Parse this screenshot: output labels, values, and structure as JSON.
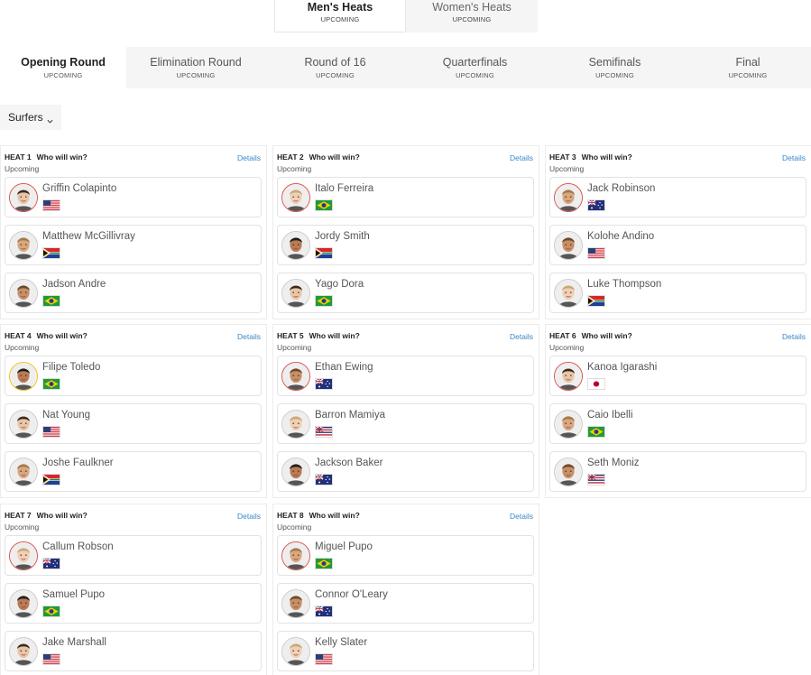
{
  "gender_tabs": [
    {
      "label": "Men's Heats",
      "status": "UPCOMING",
      "active": true
    },
    {
      "label": "Women's Heats",
      "status": "UPCOMING",
      "active": false
    }
  ],
  "round_tabs": [
    {
      "label": "Opening Round",
      "status": "UPCOMING",
      "active": true
    },
    {
      "label": "Elimination Round",
      "status": "UPCOMING",
      "active": false
    },
    {
      "label": "Round of 16",
      "status": "UPCOMING",
      "active": false
    },
    {
      "label": "Quarterfinals",
      "status": "UPCOMING",
      "active": false
    },
    {
      "label": "Semifinals",
      "status": "UPCOMING",
      "active": false
    },
    {
      "label": "Final",
      "status": "UPCOMING",
      "active": false
    }
  ],
  "filter": {
    "label": "Surfers"
  },
  "heat_question": "Who will win?",
  "heat_status": "Upcoming",
  "details_label": "Details",
  "heats": [
    {
      "label": "HEAT 1",
      "surfers": [
        {
          "name": "Griffin Colapinto",
          "flag": "usa",
          "ring": "red"
        },
        {
          "name": "Matthew McGillivray",
          "flag": "south-africa",
          "ring": "none"
        },
        {
          "name": "Jadson Andre",
          "flag": "brazil",
          "ring": "none"
        }
      ]
    },
    {
      "label": "HEAT 2",
      "surfers": [
        {
          "name": "Italo Ferreira",
          "flag": "brazil",
          "ring": "red"
        },
        {
          "name": "Jordy Smith",
          "flag": "south-africa",
          "ring": "none"
        },
        {
          "name": "Yago Dora",
          "flag": "brazil",
          "ring": "none"
        }
      ]
    },
    {
      "label": "HEAT 3",
      "surfers": [
        {
          "name": "Jack Robinson",
          "flag": "australia",
          "ring": "red"
        },
        {
          "name": "Kolohe Andino",
          "flag": "usa",
          "ring": "none"
        },
        {
          "name": "Luke Thompson",
          "flag": "south-africa",
          "ring": "none"
        }
      ]
    },
    {
      "label": "HEAT 4",
      "surfers": [
        {
          "name": "Filipe Toledo",
          "flag": "brazil",
          "ring": "yellow"
        },
        {
          "name": "Nat Young",
          "flag": "usa",
          "ring": "none"
        },
        {
          "name": "Joshe Faulkner",
          "flag": "south-africa",
          "ring": "none"
        }
      ]
    },
    {
      "label": "HEAT 5",
      "surfers": [
        {
          "name": "Ethan Ewing",
          "flag": "australia",
          "ring": "red"
        },
        {
          "name": "Barron Mamiya",
          "flag": "hawaii",
          "ring": "none"
        },
        {
          "name": "Jackson Baker",
          "flag": "australia",
          "ring": "none"
        }
      ]
    },
    {
      "label": "HEAT 6",
      "surfers": [
        {
          "name": "Kanoa Igarashi",
          "flag": "japan",
          "ring": "red"
        },
        {
          "name": "Caio Ibelli",
          "flag": "brazil",
          "ring": "none"
        },
        {
          "name": "Seth Moniz",
          "flag": "hawaii",
          "ring": "none"
        }
      ]
    },
    {
      "label": "HEAT 7",
      "surfers": [
        {
          "name": "Callum Robson",
          "flag": "australia",
          "ring": "red"
        },
        {
          "name": "Samuel Pupo",
          "flag": "brazil",
          "ring": "none"
        },
        {
          "name": "Jake Marshall",
          "flag": "usa",
          "ring": "none"
        }
      ]
    },
    {
      "label": "HEAT 8",
      "surfers": [
        {
          "name": "Miguel Pupo",
          "flag": "brazil",
          "ring": "red"
        },
        {
          "name": "Connor O'Leary",
          "flag": "australia",
          "ring": "none"
        },
        {
          "name": "Kelly Slater",
          "flag": "usa",
          "ring": "none"
        }
      ]
    }
  ],
  "colors": {
    "link": "#3a87c8",
    "ring_red": "#d9534f",
    "ring_yellow": "#f0c419",
    "tab_bg": "#f5f5f5"
  }
}
